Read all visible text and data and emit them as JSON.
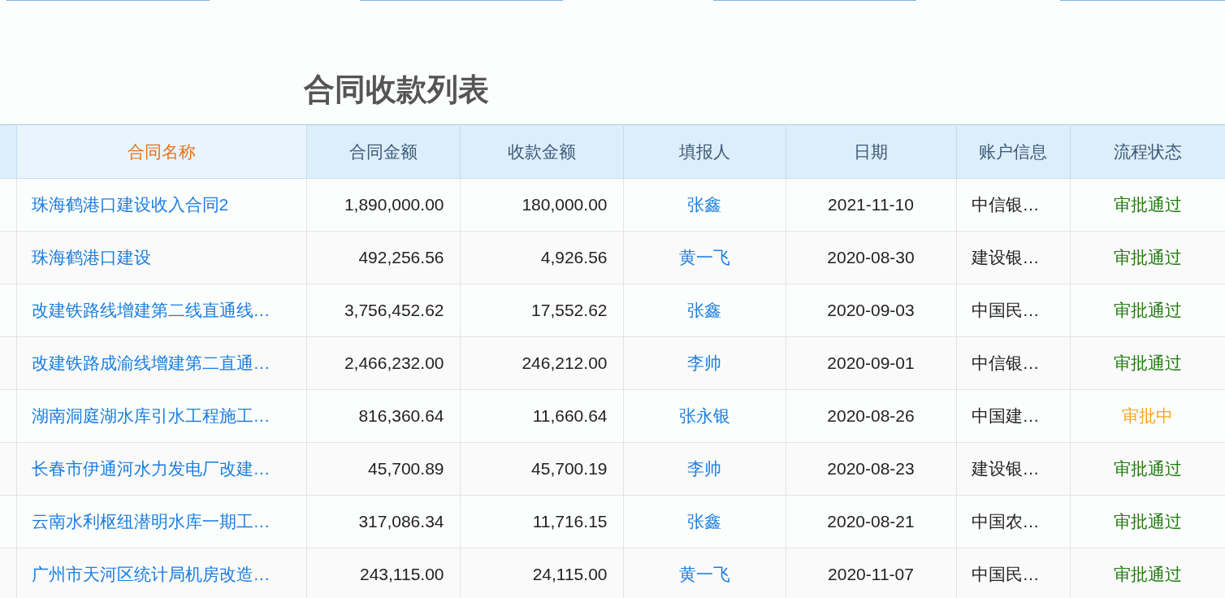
{
  "title": "合同收款列表",
  "table": {
    "columns": [
      {
        "label": "合同名称",
        "selected": true
      },
      {
        "label": "合同金额",
        "selected": false
      },
      {
        "label": "收款金额",
        "selected": false
      },
      {
        "label": "填报人",
        "selected": false
      },
      {
        "label": "日期",
        "selected": false
      },
      {
        "label": "账户信息",
        "selected": false
      },
      {
        "label": "流程状态",
        "selected": false
      }
    ],
    "rows": [
      {
        "name": "珠海鹤港口建设收入合同2",
        "amount": "1,890,000.00",
        "received": "180,000.00",
        "reporter": "张鑫",
        "date": "2021-11-10",
        "account": "中信银…",
        "status": {
          "text": "审批通过",
          "color": "#1f7a0f"
        }
      },
      {
        "name": "珠海鹤港口建设",
        "amount": "492,256.56",
        "received": "4,926.56",
        "reporter": "黄一飞",
        "date": "2020-08-30",
        "account": "建设银…",
        "status": {
          "text": "审批通过",
          "color": "#1f7a0f"
        }
      },
      {
        "name": "改建铁路线增建第二线直通线…",
        "amount": "3,756,452.62",
        "received": "17,552.62",
        "reporter": "张鑫",
        "date": "2020-09-03",
        "account": "中国民…",
        "status": {
          "text": "审批通过",
          "color": "#1f7a0f"
        }
      },
      {
        "name": "改建铁路成渝线增建第二直通…",
        "amount": "2,466,232.00",
        "received": "246,212.00",
        "reporter": "李帅",
        "date": "2020-09-01",
        "account": "中信银…",
        "status": {
          "text": "审批通过",
          "color": "#1f7a0f"
        }
      },
      {
        "name": "湖南洞庭湖水库引水工程施工…",
        "amount": "816,360.64",
        "received": "11,660.64",
        "reporter": "张永银",
        "date": "2020-08-26",
        "account": "中国建…",
        "status": {
          "text": "审批中",
          "color": "#f5a623"
        }
      },
      {
        "name": "长春市伊通河水力发电厂改建…",
        "amount": "45,700.89",
        "received": "45,700.19",
        "reporter": "李帅",
        "date": "2020-08-23",
        "account": "建设银…",
        "status": {
          "text": "审批通过",
          "color": "#1f7a0f"
        }
      },
      {
        "name": "云南水利枢纽潜明水库一期工…",
        "amount": "317,086.34",
        "received": "11,716.15",
        "reporter": "张鑫",
        "date": "2020-08-21",
        "account": "中国农…",
        "status": {
          "text": "审批通过",
          "color": "#1f7a0f"
        }
      },
      {
        "name": "广州市天河区统计局机房改造…",
        "amount": "243,115.00",
        "received": "24,115.00",
        "reporter": "黄一飞",
        "date": "2020-11-07",
        "account": "中国民…",
        "status": {
          "text": "审批通过",
          "color": "#1f7a0f"
        }
      }
    ]
  }
}
